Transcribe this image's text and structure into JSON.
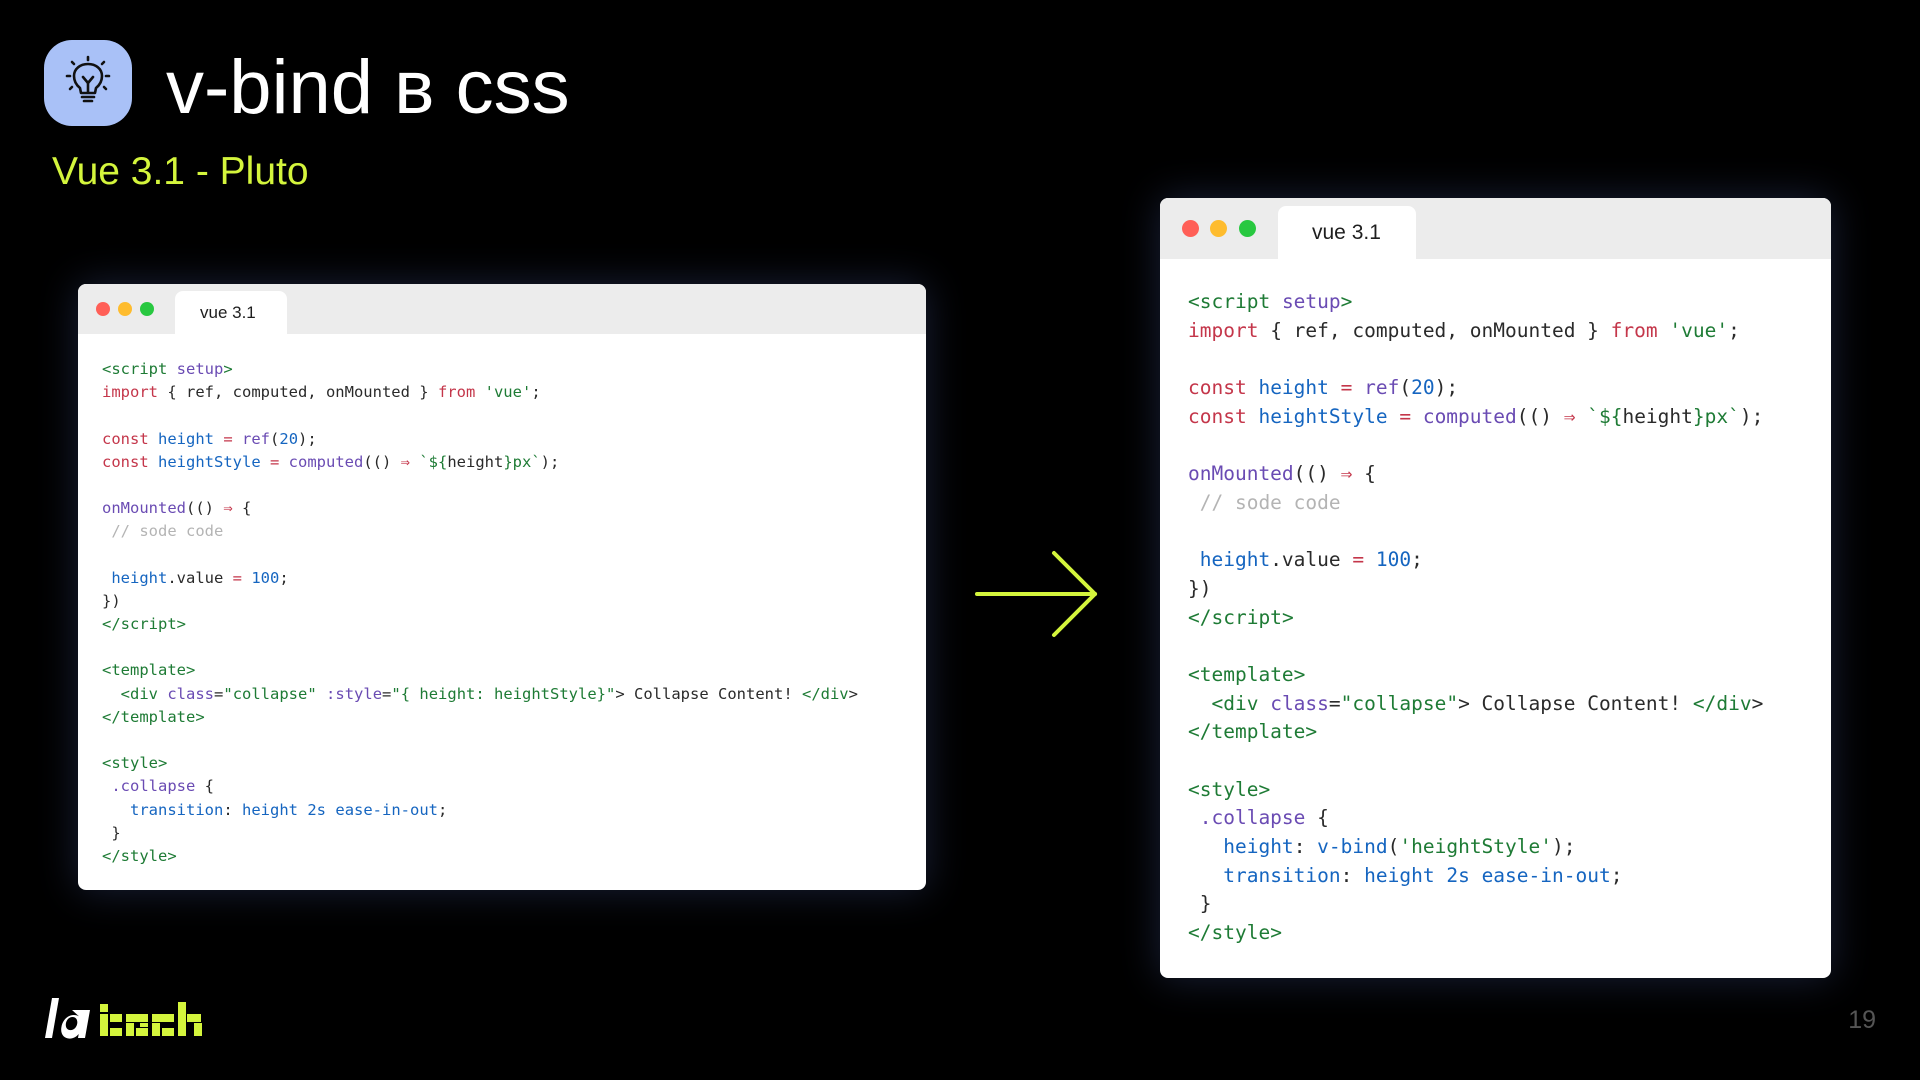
{
  "slide": {
    "title": "v-bind в css",
    "subtitle": "Vue 3.1 - Pluto",
    "page_number": "19",
    "colors": {
      "accent": "#d4f53c",
      "icon_bg": "#a9c1f7",
      "background": "#000000"
    },
    "icons": {
      "title": "lightbulb-icon",
      "transition": "arrow-right-icon",
      "brand": "latech-logo"
    }
  },
  "editors": [
    {
      "tab_label": "vue 3.1",
      "lines": [
        [
          [
            "tag",
            "<"
          ],
          [
            "tag",
            "script"
          ],
          [
            "attr",
            " setup"
          ],
          [
            "tag",
            ">"
          ]
        ],
        [
          [
            "kw",
            "import"
          ],
          [
            "punc",
            " { ref, computed, onMounted } "
          ],
          [
            "kw",
            "from"
          ],
          [
            "punc",
            " "
          ],
          [
            "str",
            "'vue'"
          ],
          [
            "punc",
            ";"
          ]
        ],
        [],
        [
          [
            "kw",
            "const"
          ],
          [
            "punc",
            " "
          ],
          [
            "var",
            "height"
          ],
          [
            "op",
            " = "
          ],
          [
            "fn",
            "ref"
          ],
          [
            "punc",
            "("
          ],
          [
            "num",
            "20"
          ],
          [
            "punc",
            ");"
          ]
        ],
        [
          [
            "kw",
            "const"
          ],
          [
            "punc",
            " "
          ],
          [
            "var",
            "heightStyle"
          ],
          [
            "op",
            " = "
          ],
          [
            "fn",
            "computed"
          ],
          [
            "punc",
            "(() "
          ],
          [
            "op",
            "⇒"
          ],
          [
            "punc",
            " "
          ],
          [
            "str",
            "`${"
          ],
          [
            "punc",
            "height"
          ],
          [
            "str",
            "}px`"
          ],
          [
            "punc",
            ");"
          ]
        ],
        [],
        [
          [
            "fn",
            "onMounted"
          ],
          [
            "punc",
            "(() "
          ],
          [
            "op",
            "⇒"
          ],
          [
            "punc",
            " {"
          ]
        ],
        [
          [
            "cm",
            " // sode code"
          ]
        ],
        [],
        [
          [
            "var",
            " height"
          ],
          [
            "punc",
            ".value "
          ],
          [
            "op",
            "="
          ],
          [
            "punc",
            " "
          ],
          [
            "num",
            "100"
          ],
          [
            "punc",
            ";"
          ]
        ],
        [
          [
            "punc",
            "})"
          ]
        ],
        [
          [
            "tag",
            "</"
          ],
          [
            "tag",
            "script"
          ],
          [
            "tag",
            ">"
          ]
        ],
        [],
        [
          [
            "tag",
            "<"
          ],
          [
            "tag",
            "template"
          ],
          [
            "tag",
            ">"
          ]
        ],
        [
          [
            "punc",
            "  "
          ],
          [
            "tag",
            "<div"
          ],
          [
            "punc",
            " "
          ],
          [
            "attr",
            "class"
          ],
          [
            "punc",
            "="
          ],
          [
            "str",
            "\"collapse\""
          ],
          [
            "punc",
            " "
          ],
          [
            "attr",
            ":style"
          ],
          [
            "punc",
            "="
          ],
          [
            "str",
            "\"{ height: heightStyle}\""
          ],
          [
            "punc",
            "> Collapse Content! "
          ],
          [
            "tag",
            "</div"
          ],
          [
            "punc",
            ">"
          ]
        ],
        [
          [
            "tag",
            "</"
          ],
          [
            "tag",
            "template"
          ],
          [
            "tag",
            ">"
          ]
        ],
        [],
        [
          [
            "tag",
            "<"
          ],
          [
            "tag",
            "style"
          ],
          [
            "tag",
            ">"
          ]
        ],
        [
          [
            "sel",
            " .collapse"
          ],
          [
            "punc",
            " {"
          ]
        ],
        [
          [
            "punc",
            "   "
          ],
          [
            "prop",
            "transition"
          ],
          [
            "punc",
            ": "
          ],
          [
            "var",
            "height"
          ],
          [
            "punc",
            " "
          ],
          [
            "num",
            "2s"
          ],
          [
            "punc",
            " "
          ],
          [
            "var",
            "ease-in-out"
          ],
          [
            "punc",
            ";"
          ]
        ],
        [
          [
            "punc",
            " }"
          ]
        ],
        [
          [
            "tag",
            "</"
          ],
          [
            "tag",
            "style"
          ],
          [
            "tag",
            ">"
          ]
        ]
      ]
    },
    {
      "tab_label": "vue 3.1",
      "lines": [
        [
          [
            "tag",
            "<"
          ],
          [
            "tag",
            "script"
          ],
          [
            "attr",
            " setup"
          ],
          [
            "tag",
            ">"
          ]
        ],
        [
          [
            "kw",
            "import"
          ],
          [
            "punc",
            " { ref, computed, onMounted } "
          ],
          [
            "kw",
            "from"
          ],
          [
            "punc",
            " "
          ],
          [
            "str",
            "'vue'"
          ],
          [
            "punc",
            ";"
          ]
        ],
        [],
        [
          [
            "kw",
            "const"
          ],
          [
            "punc",
            " "
          ],
          [
            "var",
            "height"
          ],
          [
            "op",
            " = "
          ],
          [
            "fn",
            "ref"
          ],
          [
            "punc",
            "("
          ],
          [
            "num",
            "20"
          ],
          [
            "punc",
            ");"
          ]
        ],
        [
          [
            "kw",
            "const"
          ],
          [
            "punc",
            " "
          ],
          [
            "var",
            "heightStyle"
          ],
          [
            "op",
            " = "
          ],
          [
            "fn",
            "computed"
          ],
          [
            "punc",
            "(() "
          ],
          [
            "op",
            "⇒"
          ],
          [
            "punc",
            " "
          ],
          [
            "str",
            "`${"
          ],
          [
            "punc",
            "height"
          ],
          [
            "str",
            "}px`"
          ],
          [
            "punc",
            ");"
          ]
        ],
        [],
        [
          [
            "fn",
            "onMounted"
          ],
          [
            "punc",
            "(() "
          ],
          [
            "op",
            "⇒"
          ],
          [
            "punc",
            " {"
          ]
        ],
        [
          [
            "cm",
            " // sode code"
          ]
        ],
        [],
        [
          [
            "var",
            " height"
          ],
          [
            "punc",
            ".value "
          ],
          [
            "op",
            "="
          ],
          [
            "punc",
            " "
          ],
          [
            "num",
            "100"
          ],
          [
            "punc",
            ";"
          ]
        ],
        [
          [
            "punc",
            "})"
          ]
        ],
        [
          [
            "tag",
            "</"
          ],
          [
            "tag",
            "script"
          ],
          [
            "tag",
            ">"
          ]
        ],
        [],
        [
          [
            "tag",
            "<"
          ],
          [
            "tag",
            "template"
          ],
          [
            "tag",
            ">"
          ]
        ],
        [
          [
            "punc",
            "  "
          ],
          [
            "tag",
            "<div"
          ],
          [
            "punc",
            " "
          ],
          [
            "attr",
            "class"
          ],
          [
            "punc",
            "="
          ],
          [
            "str",
            "\"collapse\""
          ],
          [
            "punc",
            "> Collapse Content! "
          ],
          [
            "tag",
            "</div"
          ],
          [
            "punc",
            ">"
          ]
        ],
        [
          [
            "tag",
            "</"
          ],
          [
            "tag",
            "template"
          ],
          [
            "tag",
            ">"
          ]
        ],
        [],
        [
          [
            "tag",
            "<"
          ],
          [
            "tag",
            "style"
          ],
          [
            "tag",
            ">"
          ]
        ],
        [
          [
            "sel",
            " .collapse"
          ],
          [
            "punc",
            " {"
          ]
        ],
        [
          [
            "punc",
            "   "
          ],
          [
            "prop",
            "height"
          ],
          [
            "punc",
            ": "
          ],
          [
            "var",
            "v-bind"
          ],
          [
            "punc",
            "("
          ],
          [
            "str",
            "'heightStyle'"
          ],
          [
            "punc",
            ");"
          ]
        ],
        [
          [
            "punc",
            "   "
          ],
          [
            "prop",
            "transition"
          ],
          [
            "punc",
            ": "
          ],
          [
            "var",
            "height"
          ],
          [
            "punc",
            " "
          ],
          [
            "num",
            "2s"
          ],
          [
            "punc",
            " "
          ],
          [
            "var",
            "ease-in-out"
          ],
          [
            "punc",
            ";"
          ]
        ],
        [
          [
            "punc",
            " }"
          ]
        ],
        [
          [
            "tag",
            "</"
          ],
          [
            "tag",
            "style"
          ],
          [
            "tag",
            ">"
          ]
        ]
      ]
    }
  ]
}
